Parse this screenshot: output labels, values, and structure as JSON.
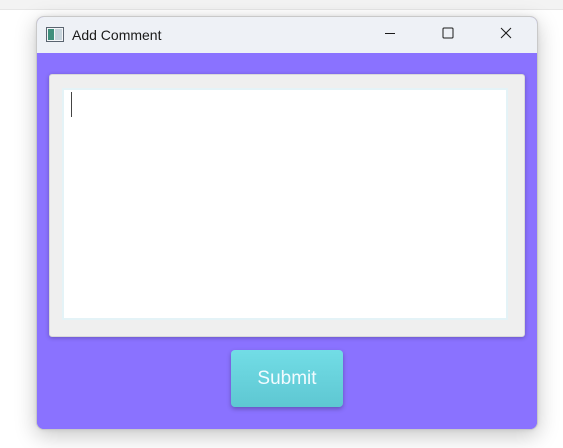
{
  "window": {
    "title": "Add Comment",
    "app_icon": "window-app-icon",
    "controls": {
      "minimize_icon": "minimize-icon",
      "maximize_icon": "maximize-icon",
      "close_icon": "close-icon"
    }
  },
  "form": {
    "comment_value": "",
    "submit_label": "Submit"
  },
  "colors": {
    "client_background": "#8a72ff",
    "titlebar_background": "#eef1f6",
    "button_top": "#72dde6",
    "button_bottom": "#5ec7d2",
    "button_text": "#f2fbff"
  }
}
